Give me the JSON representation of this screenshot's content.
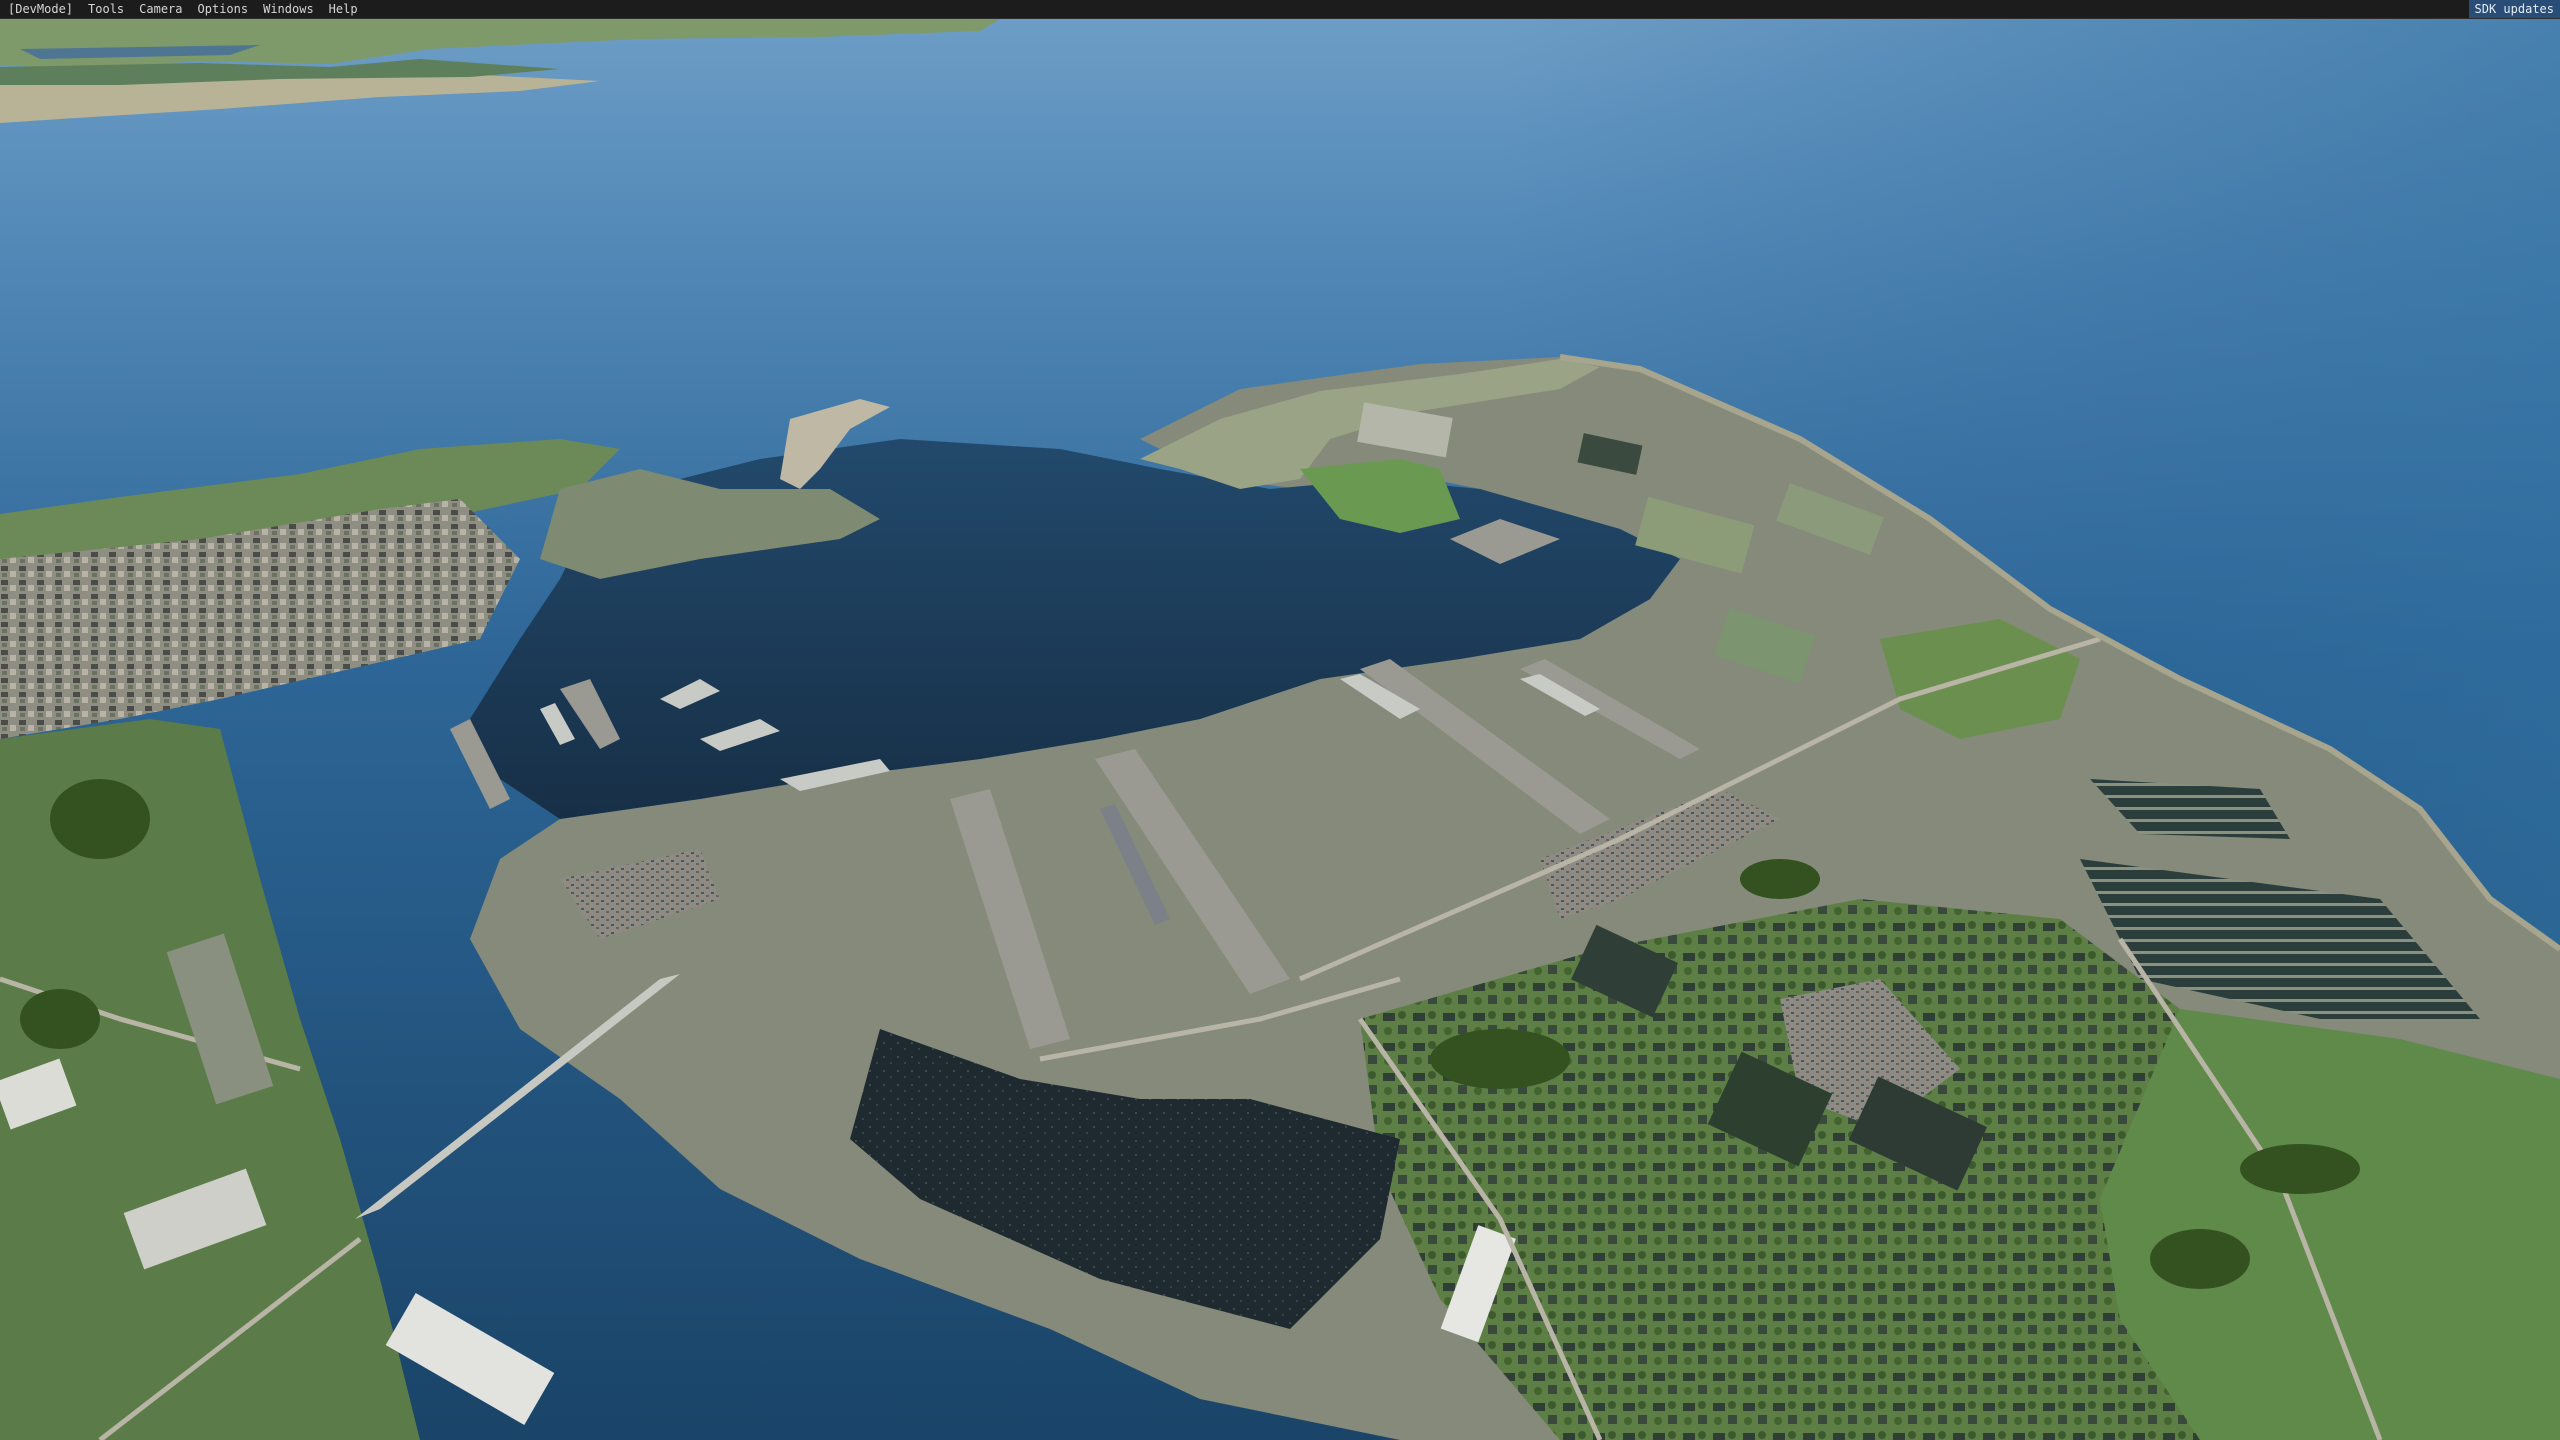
{
  "menubar": {
    "items": [
      {
        "label": "[DevMode]"
      },
      {
        "label": "Tools"
      },
      {
        "label": "Camera"
      },
      {
        "label": "Options"
      },
      {
        "label": "Windows"
      },
      {
        "label": "Help"
      }
    ],
    "sdk_updates_label": "SDK updates"
  },
  "viewport": {
    "scene": "aerial-view-naval-harbour",
    "colors": {
      "sea_far": "#5f93bf",
      "sea_near": "#1d4b74",
      "harbour_water": "#1b3c5a",
      "grass": "#5f8a4a",
      "land": "#8f9286",
      "roof_dark": "#1f2a30",
      "menu_bg": "#1c1c1c",
      "menu_accent": "#2a4d78"
    }
  }
}
